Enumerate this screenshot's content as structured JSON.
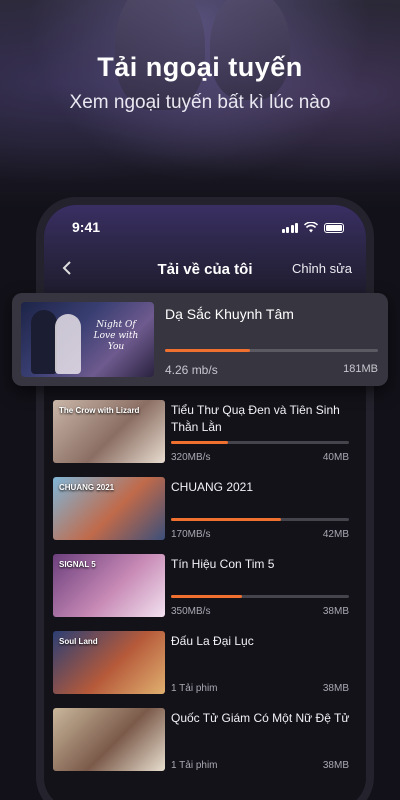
{
  "hero": {
    "title": "Tải ngoại tuyến",
    "subtitle": "Xem ngoại tuyến bất kì lúc nào"
  },
  "status": {
    "time": "9:41"
  },
  "nav": {
    "back_icon": "chevron-left-icon",
    "title": "Tải về của tôi",
    "edit_label": "Chỉnh sửa"
  },
  "featured": {
    "title": "Dạ Sắc Khuynh Tâm",
    "speed": "4.26 mb/s",
    "size": "181MB",
    "progress": 0.4,
    "thumb_text": "Night Of Love with You"
  },
  "items": [
    {
      "title": "Tiểu Thư Quạ Đen và Tiên Sinh Thằn Lằn",
      "speed": "320MB/s",
      "size": "40MB",
      "progress": 0.32,
      "thumb_text": "The Crow with Lizard",
      "colors": [
        "#c9b6a8",
        "#8b6e63",
        "#e8dcd0"
      ]
    },
    {
      "title": "CHUANG 2021",
      "speed": "170MB/s",
      "size": "42MB",
      "progress": 0.62,
      "thumb_text": "CHUANG 2021",
      "colors": [
        "#7fb6d8",
        "#c06a4a",
        "#3b4f7a"
      ]
    },
    {
      "title": "Tín Hiệu Con Tim 5",
      "speed": "350MB/s",
      "size": "38MB",
      "progress": 0.4,
      "thumb_text": "SIGNAL 5",
      "colors": [
        "#6b3f7d",
        "#c789b5",
        "#f2e2ef"
      ]
    },
    {
      "title": "Đấu La Đại Lục",
      "speed": "1 Tải phim",
      "size": "38MB",
      "progress": null,
      "thumb_text": "Soul Land",
      "colors": [
        "#2b3f74",
        "#b65a3a",
        "#e0b070"
      ]
    },
    {
      "title": "Quốc Tử Giám Có Một Nữ Đệ Tử",
      "speed": "1 Tải phim",
      "size": "38MB",
      "progress": null,
      "thumb_text": "",
      "colors": [
        "#c9b79b",
        "#7b5a4a",
        "#e8dfcf"
      ]
    }
  ],
  "colors": {
    "accent": "#f07030",
    "background": "#121119"
  }
}
